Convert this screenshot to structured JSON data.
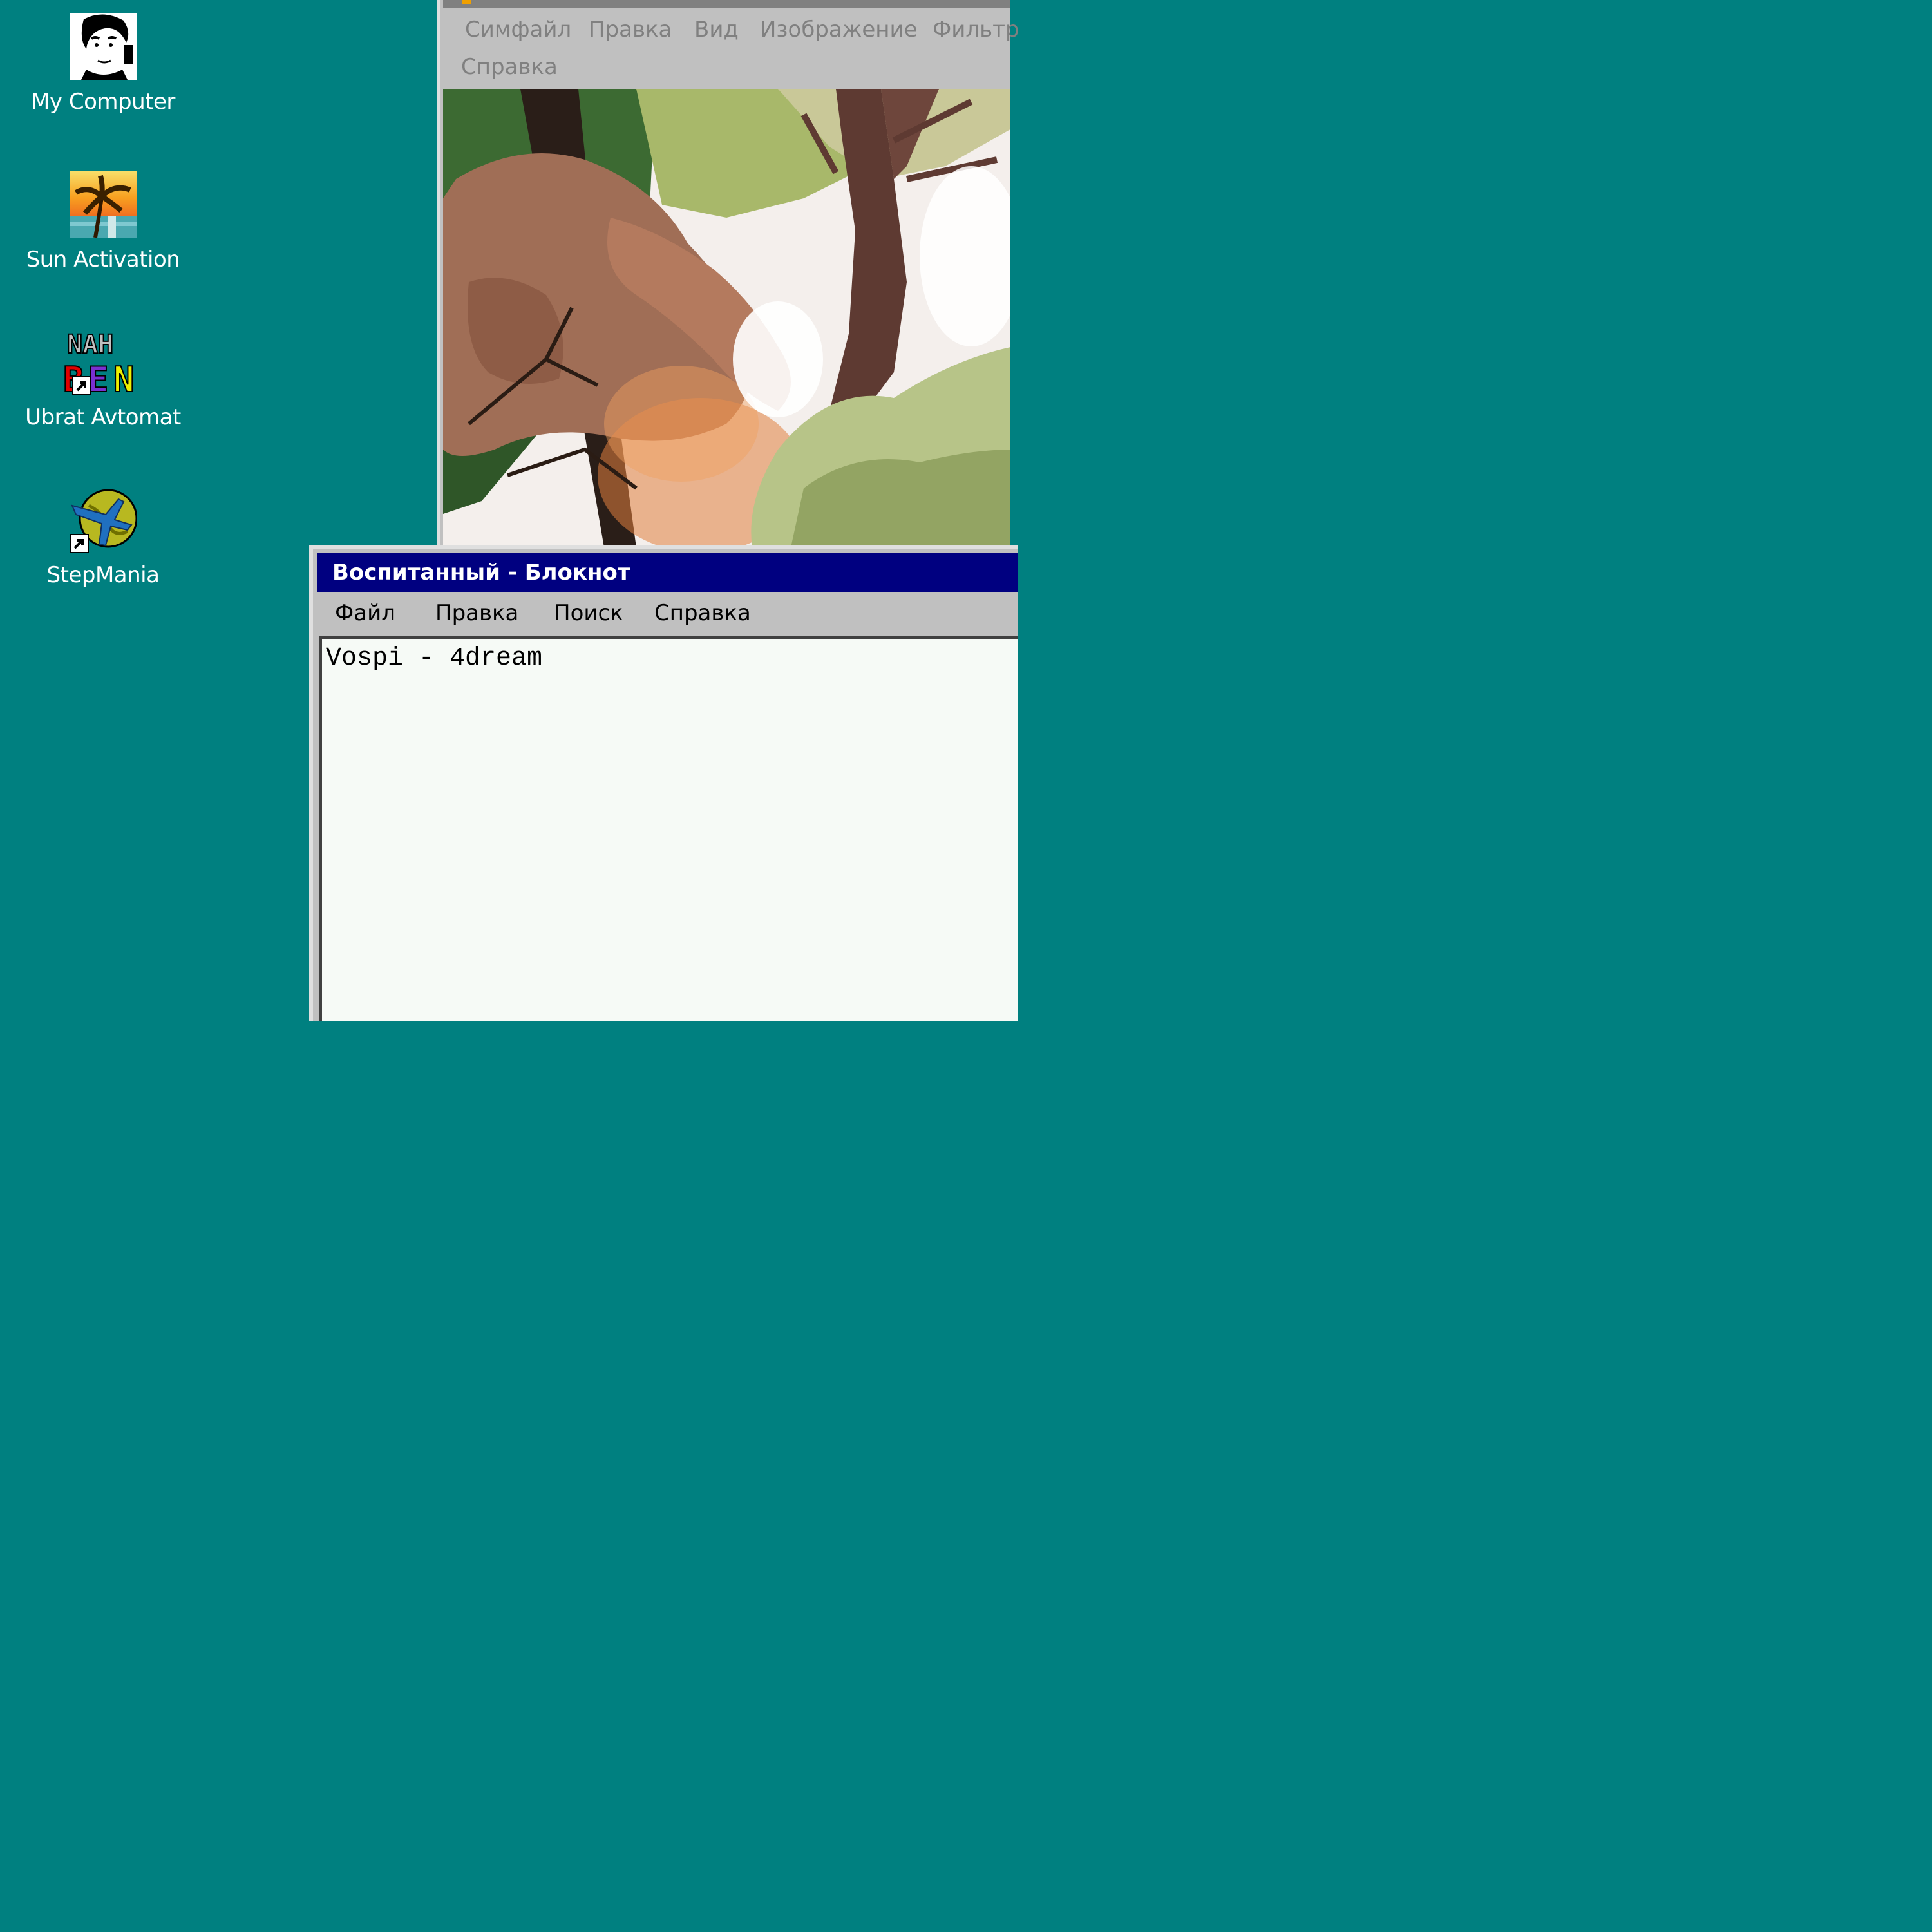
{
  "desktop": {
    "background_color": "#008080",
    "icons": [
      {
        "label": "My Computer",
        "icon": "avatar-portrait-icon",
        "shortcut": false
      },
      {
        "label": "Sun Activation",
        "icon": "palm-tree-sunset-icon",
        "shortcut": false
      },
      {
        "label": "Ubrat Avtomat",
        "icon": "nah-ben-logo-icon",
        "shortcut": true
      },
      {
        "label": "StepMania",
        "icon": "globe-plane-icon",
        "shortcut": true
      }
    ]
  },
  "paint_window": {
    "menu": [
      "Симфайл",
      "Правка",
      "Вид",
      "Изображение",
      "Фильтр",
      "Справка"
    ],
    "canvas_content": "photo of trees with orange sunlit leaves"
  },
  "notepad": {
    "title": "Воспитанный - Блокнот",
    "menu": [
      "Файл",
      "Правка",
      "Поиск",
      "Справка"
    ],
    "text": "Vospi - 4dream"
  },
  "colors": {
    "title_active": "#000080",
    "window_face": "#c0c0c0",
    "menu_disabled": "#808080"
  }
}
